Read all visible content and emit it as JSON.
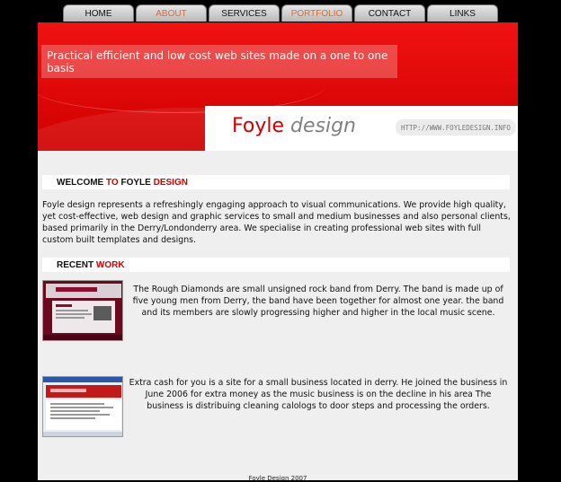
{
  "nav": {
    "items": [
      {
        "label": "HOME"
      },
      {
        "label": "ABOUT"
      },
      {
        "label": "SERVICES"
      },
      {
        "label": "PORTFOLIO"
      },
      {
        "label": "CONTACT"
      },
      {
        "label": "LINKS"
      }
    ]
  },
  "header": {
    "tagline": "Practical efficient and low cost web sites made on a one to one basis",
    "logo_part1": "Foyle",
    "logo_part2": "design",
    "url": "HTTP://WWW.FOYLEDESIGN.INFO"
  },
  "welcome": {
    "heading_part1": "WELCOME ",
    "heading_part2": "TO ",
    "heading_part3": "FOYLE ",
    "heading_part4": "DESIGN",
    "body": "Foyle design represents a refreshingly engaging approach to visual communications. We provide high quality, yet cost-effective, web design and graphic services to small and medium businesses and also personal clients, based primarily in the Derry/Londonderry area. We specialise in creating professional web sites with full custom built templates and designs."
  },
  "recent": {
    "heading_part1": "RECENT ",
    "heading_part2": "WORK",
    "items": [
      {
        "text": "The Rough Diamonds are small unsigned rock band from Derry. The band is made up of five young men from Derry, the band have been together for almost one year. the band and its members are slowly progressing higher and higher in the local music scene."
      },
      {
        "text": "Extra cash for you is a site for a small business located in derry. He joined the business in June 2006 for extra money as the music business is on the decline in his area The business is distribuing cleaning calologs to door steps and processing the orders."
      }
    ]
  },
  "footer": {
    "text": "Foyle Design 2007"
  },
  "colors": {
    "brand_red": "#d00000",
    "nav_accent": "#e06a2a"
  }
}
